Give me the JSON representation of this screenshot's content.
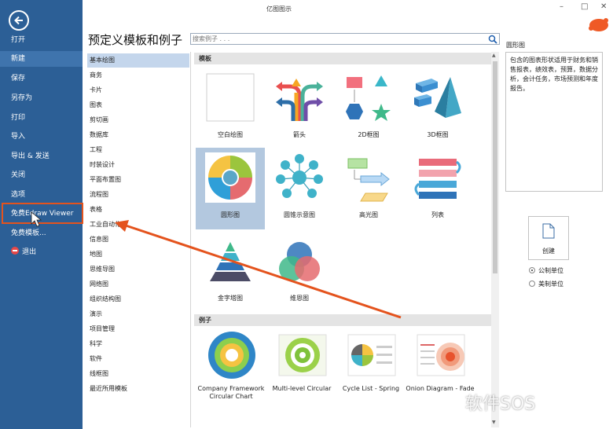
{
  "window": {
    "title": "亿图图示",
    "minimize": "–",
    "maximize": "□",
    "close": "✕"
  },
  "nav": {
    "items": [
      {
        "label": "打开"
      },
      {
        "label": "新建"
      },
      {
        "label": "保存"
      },
      {
        "label": "另存为"
      },
      {
        "label": "打印"
      },
      {
        "label": "导入"
      },
      {
        "label": "导出 & 发送"
      },
      {
        "label": "关闭"
      },
      {
        "label": "选项"
      },
      {
        "label": "免费Edraw Viewer"
      },
      {
        "label": "免费模板..."
      },
      {
        "label": "退出"
      }
    ],
    "active_index": 1,
    "highlight_index": 9,
    "accent": "#2c5f96",
    "highlight_color": "#e4531d"
  },
  "header": {
    "title": "预定义模板和例子",
    "search_placeholder": "搜索例子 . . ."
  },
  "categories": [
    "基本绘图",
    "商务",
    "卡片",
    "图表",
    "剪切画",
    "数据库",
    "工程",
    "时装设计",
    "平面布置图",
    "流程图",
    "表格",
    "工业自动化",
    "信息图",
    "地图",
    "思维导图",
    "网络图",
    "组织结构图",
    "演示",
    "项目管理",
    "科学",
    "软件",
    "线框图",
    "最近所用模板"
  ],
  "templates": {
    "section_label": "模板",
    "tiles": [
      {
        "label": "空白绘图",
        "icon": "blank-page-icon"
      },
      {
        "label": "箭头",
        "icon": "arrows-icon"
      },
      {
        "label": "2D框图",
        "icon": "2d-block-icon"
      },
      {
        "label": "3D框图",
        "icon": "3d-block-icon"
      },
      {
        "label": "圆形图",
        "icon": "circular-diagram-icon"
      },
      {
        "label": "圆锥示意图",
        "icon": "radial-diagram-icon"
      },
      {
        "label": "高光图",
        "icon": "highlight-diagram-icon"
      },
      {
        "label": "列表",
        "icon": "list-diagram-icon"
      },
      {
        "label": "金字塔图",
        "icon": "pyramid-icon"
      },
      {
        "label": "维恩图",
        "icon": "venn-icon"
      }
    ],
    "selected_index": 4
  },
  "examples": {
    "section_label": "例子",
    "tiles": [
      {
        "label": "Company Framework Circular Chart"
      },
      {
        "label": "Multi-level Circular"
      },
      {
        "label": "Cycle List - Spring"
      },
      {
        "label": "Onion Diagram - Fade"
      }
    ]
  },
  "detail": {
    "title": "圆形图",
    "description": "包含的图表形状适用于财务和销售报表，绩效表，预算，数据分析，会计任务，市场预测和年度报告。",
    "create_label": "创建",
    "units": [
      {
        "label": "公制单位",
        "selected": true
      },
      {
        "label": "美制单位",
        "selected": false
      }
    ]
  },
  "watermark": "软件SOS"
}
